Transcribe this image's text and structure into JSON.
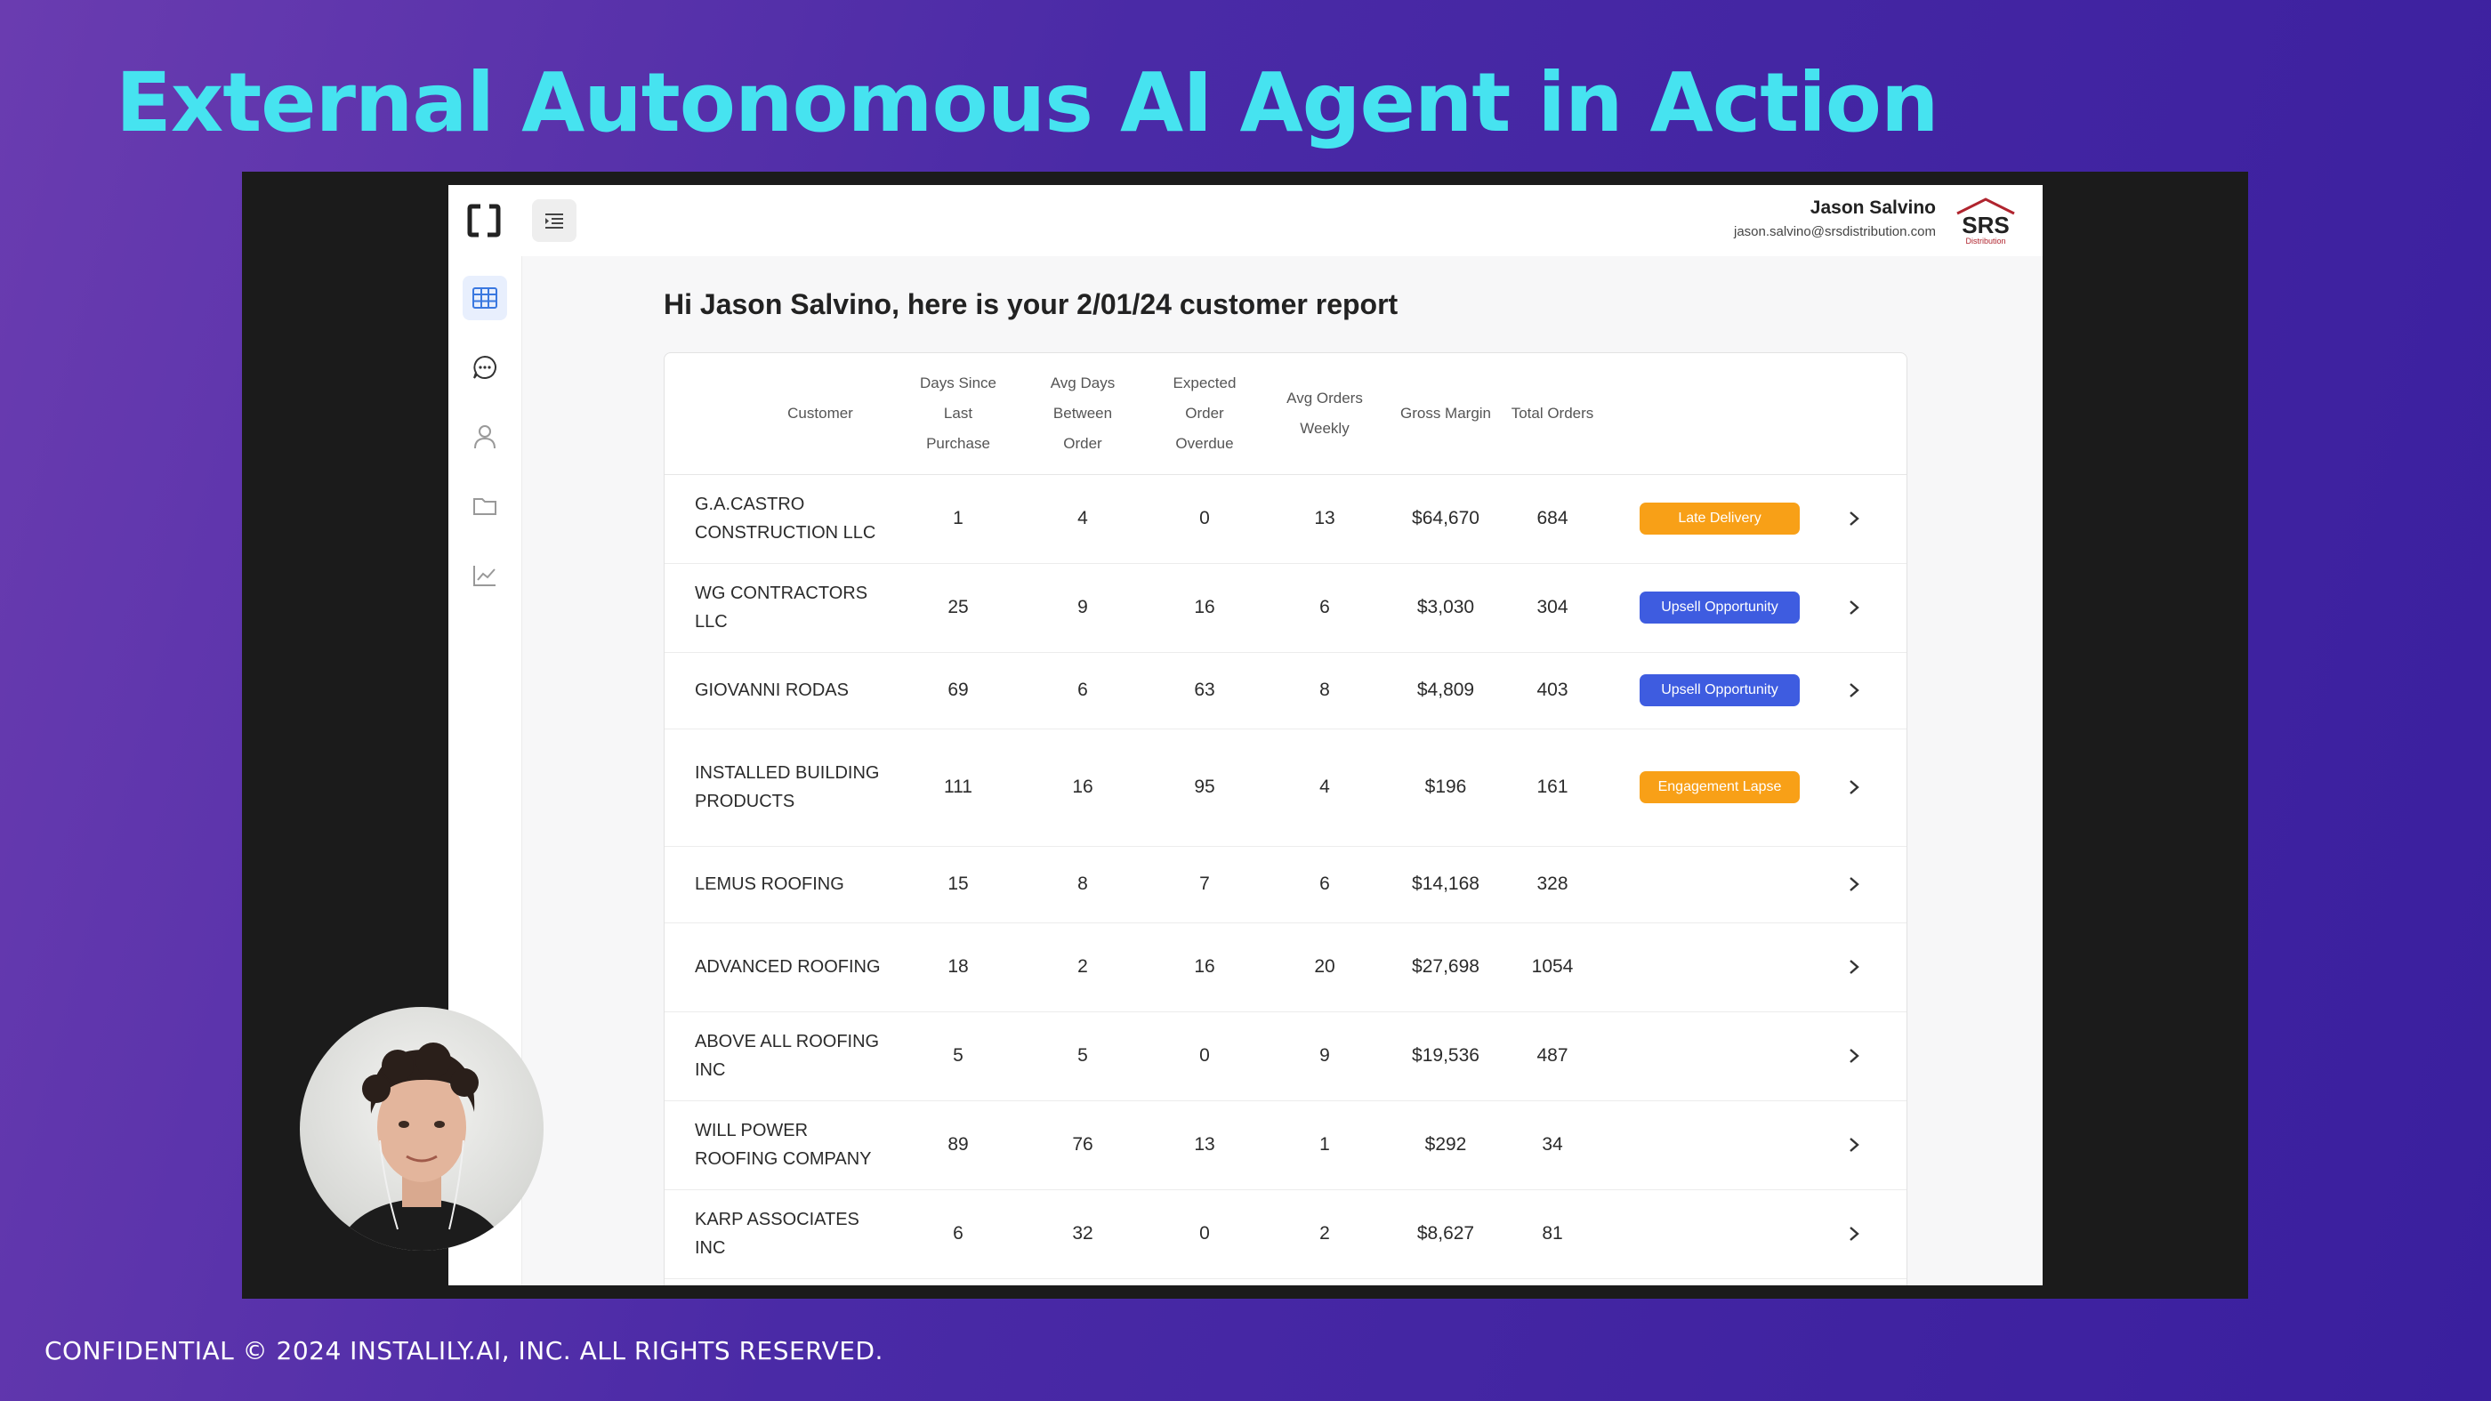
{
  "slide": {
    "title": "External Autonomous AI Agent in Action",
    "footer": "CONFIDENTIAL © 2024 INSTALILY.AI, INC. ALL RIGHTS RESERVED."
  },
  "app": {
    "user": {
      "name": "Jason Salvino",
      "email": "jason.salvino@srsdistribution.com"
    },
    "brand_logo_text": "SRS Distribution",
    "sidebar": {
      "items": [
        "table-icon",
        "chat-icon",
        "user-icon",
        "folder-icon",
        "chart-icon"
      ],
      "active": "table-icon"
    },
    "heading": "Hi Jason Salvino, here is your 2/01/24 customer report",
    "table": {
      "columns": [
        "Customer",
        "Days Since Last Purchase",
        "Avg Days Between Order",
        "Expected Order Overdue",
        "Avg Orders Weekly",
        "Gross Margin",
        "Total Orders"
      ],
      "rows": [
        {
          "customer": "G.A.CASTRO CONSTRUCTION LLC",
          "days_since": "1",
          "avg_days": "4",
          "overdue": "0",
          "avg_weekly": "13",
          "margin": "$64,670",
          "orders": "684",
          "tag": "Late Delivery",
          "tag_color": "#f8a017"
        },
        {
          "customer": "WG CONTRACTORS LLC",
          "days_since": "25",
          "avg_days": "9",
          "overdue": "16",
          "avg_weekly": "6",
          "margin": "$3,030",
          "orders": "304",
          "tag": "Upsell Opportunity",
          "tag_color": "#3e5ce0"
        },
        {
          "customer": "GIOVANNI RODAS",
          "days_since": "69",
          "avg_days": "6",
          "overdue": "63",
          "avg_weekly": "8",
          "margin": "$4,809",
          "orders": "403",
          "tag": "Upsell Opportunity",
          "tag_color": "#3e5ce0"
        },
        {
          "customer": "INSTALLED BUILDING PRODUCTS",
          "days_since": "111",
          "avg_days": "16",
          "overdue": "95",
          "avg_weekly": "4",
          "margin": "$196",
          "orders": "161",
          "tag": "Engagement Lapse",
          "tag_color": "#f8a017"
        },
        {
          "customer": "LEMUS ROOFING",
          "days_since": "15",
          "avg_days": "8",
          "overdue": "7",
          "avg_weekly": "6",
          "margin": "$14,168",
          "orders": "328",
          "tag": "",
          "tag_color": ""
        },
        {
          "customer": "ADVANCED ROOFING",
          "days_since": "18",
          "avg_days": "2",
          "overdue": "16",
          "avg_weekly": "20",
          "margin": "$27,698",
          "orders": "1054",
          "tag": "",
          "tag_color": ""
        },
        {
          "customer": "ABOVE ALL ROOFING INC",
          "days_since": "5",
          "avg_days": "5",
          "overdue": "0",
          "avg_weekly": "9",
          "margin": "$19,536",
          "orders": "487",
          "tag": "",
          "tag_color": ""
        },
        {
          "customer": "WILL POWER ROOFING COMPANY",
          "days_since": "89",
          "avg_days": "76",
          "overdue": "13",
          "avg_weekly": "1",
          "margin": "$292",
          "orders": "34",
          "tag": "",
          "tag_color": ""
        },
        {
          "customer": "KARP ASSOCIATES INC",
          "days_since": "6",
          "avg_days": "32",
          "overdue": "0",
          "avg_weekly": "2",
          "margin": "$8,627",
          "orders": "81",
          "tag": "",
          "tag_color": ""
        }
      ]
    }
  },
  "colors": {
    "title": "#46e3f0",
    "late": "#f8a017",
    "upsell": "#3e5ce0",
    "accent_nav": "#3a78e0"
  }
}
